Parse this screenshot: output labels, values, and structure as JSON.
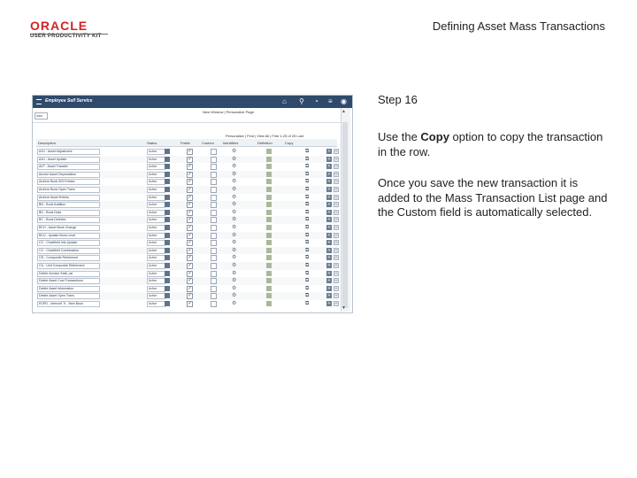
{
  "header": {
    "logo_text": "ORACLE",
    "logo_subtext": "USER PRODUCTIVITY KIT",
    "title": "Defining Asset Mass Transactions"
  },
  "screenshot": {
    "app_title": "Employee Self Service",
    "nav_links": "New Window | Personalize Page",
    "search_text": "alias",
    "grid_nav": "Personalize | Find | View All | First  1-25 of 25  Last",
    "columns": [
      "Description",
      "Status",
      "Public",
      "Custom",
      "Identifiers",
      "Definition",
      "Copy"
    ],
    "rows": [
      {
        "description": "AJU - Asset Adjustment",
        "status": "Active",
        "public": true
      },
      {
        "description": "AJU - Asset Update",
        "status": "Active",
        "public": true
      },
      {
        "description": "AVT - Asset Transfer",
        "status": "Active",
        "public": true
      },
      {
        "description": "Accrue Asset Depreciation",
        "status": "Active",
        "public": true
      },
      {
        "description": "Archive Book WO Entries",
        "status": "Active",
        "public": true
      },
      {
        "description": "Archive Book Open Trans",
        "status": "Active",
        "public": true
      },
      {
        "description": "Archive Asset Entries",
        "status": "Active",
        "public": true
      },
      {
        "description": "BN - Book Addition",
        "status": "Active",
        "public": true
      },
      {
        "description": "BD - Book Data",
        "status": "Active",
        "public": true
      },
      {
        "description": "BC - Book Deletion",
        "status": "Active",
        "public": true
      },
      {
        "description": "BCH - Asset Book Change",
        "status": "Active",
        "public": true
      },
      {
        "description": "BCU - Update Book Level",
        "status": "Active",
        "public": true
      },
      {
        "description": "CC - Chartfield Info Update",
        "status": "Active",
        "public": true
      },
      {
        "description": "CC - Chartfield Combination",
        "status": "Active",
        "public": true
      },
      {
        "description": "CN - Composite Retirement",
        "status": "Active",
        "public": true
      },
      {
        "description": "CU - Unit Composite Retirement",
        "status": "Active",
        "public": true
      },
      {
        "description": "Delete Archive Staff_ost",
        "status": "Active",
        "public": true
      },
      {
        "description": "Delete Asset Cost Transactions",
        "status": "Active",
        "public": true
      },
      {
        "description": "Delete Asset Information",
        "status": "Active",
        "public": true
      },
      {
        "description": "Delete Asset Open Trans",
        "status": "Active",
        "public": true
      },
      {
        "description": "EUPD - Interunit Tr - New Book",
        "status": "Active",
        "public": true
      }
    ]
  },
  "instructions": {
    "step": "Step 16",
    "para1_before": "Use the ",
    "para1_bold": "Copy",
    "para1_after": " option to copy the transaction in the row.",
    "para2": "Once you save the new transaction it is added to the Mass Transaction List page and the Custom field is automatically selected."
  },
  "icons": {
    "app_menu": "hamburger-icon",
    "home": "home-icon",
    "search": "search-icon",
    "notifications": "bell-icon",
    "nav": "menu-icon",
    "action": "circle-icon",
    "identifier": "gear-icon",
    "definition": "document-icon",
    "copy": "copy-icon",
    "add_row": "plus-icon",
    "delete_row": "minus-icon"
  },
  "colors": {
    "logo_red": "#d32323",
    "app_bar": "#2f4a6b"
  }
}
